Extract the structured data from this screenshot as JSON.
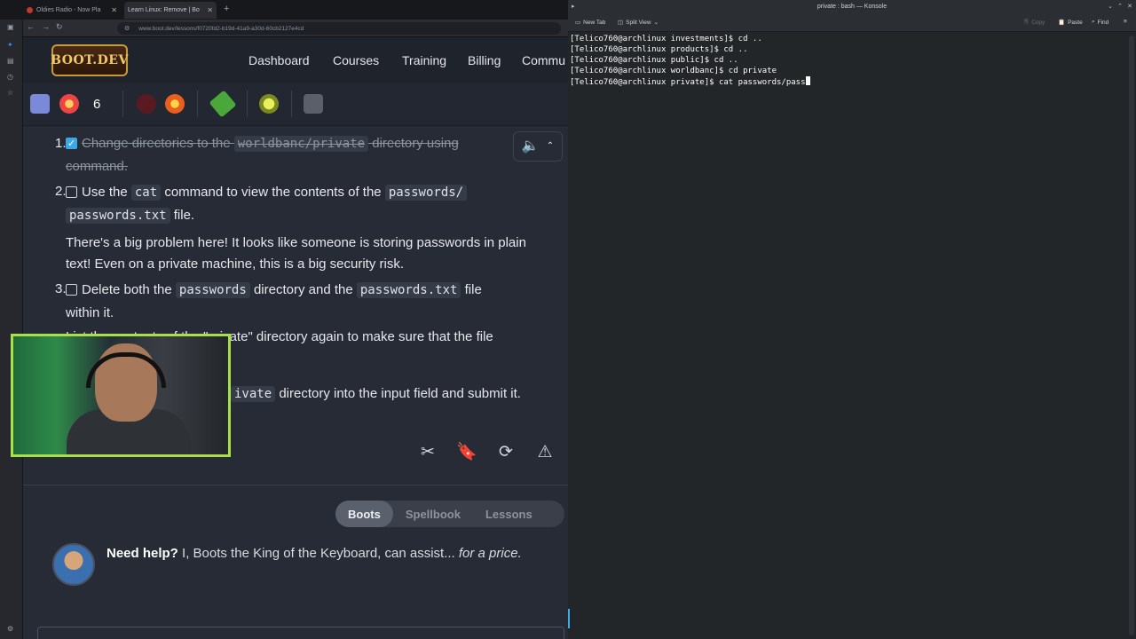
{
  "browser": {
    "tabs": [
      {
        "title": "Oldies Radio - Now Pla",
        "active": false
      },
      {
        "title": "Learn Linux: Remove | Bo",
        "active": true
      }
    ],
    "url": "www.boot.dev/lessons/f0720fd2-b19d-41a9-a30d-60cb2127e4cd"
  },
  "site": {
    "logo": "BOOT.DEV",
    "nav": [
      "Dashboard",
      "Courses",
      "Training",
      "Billing",
      "Commu"
    ],
    "streak_count": "6"
  },
  "lesson": {
    "steps": [
      {
        "num": "1.",
        "checked": true,
        "line1_pre": "Change directories to the ",
        "line1_code": "worldbanc/private",
        "line1_post": " directory using",
        "line2": "command."
      },
      {
        "num": "2.",
        "checked": false,
        "pre": "Use the ",
        "code1": "cat",
        "mid": " command to view the contents of the ",
        "code2": "passwords/",
        "code3": "passwords.txt",
        "post": " file."
      },
      {
        "num": "3.",
        "checked": false,
        "pre": "Delete both the ",
        "code1": "passwords",
        "mid": " directory and the ",
        "code2": "passwords.txt",
        "post": " file",
        "line2": "within it."
      }
    ],
    "note": "There's a big problem here! It looks like someone is storing passwords in plain text! Even on a private machine, this is a big security risk.",
    "step4_partial": "List the contents of the \"private\" directory again to make sure that the file",
    "step5_code": "ivate",
    "step5_post": " directory into the input field and submit it."
  },
  "help": {
    "tabs": [
      "Boots",
      "Spellbook",
      "Lessons"
    ],
    "active_tab": "Boots",
    "title": "Need help?",
    "text": " I, Boots the King of the Keyboard, can assist...",
    "italic": " for a price."
  },
  "terminal": {
    "window_title": "private : bash — Konsole",
    "toolbar": {
      "new_tab": "New Tab",
      "split_view": "Split View",
      "copy": "Copy",
      "paste": "Paste",
      "find": "Find"
    },
    "lines": [
      "[Telico760@archlinux investments]$ cd ..",
      "[Telico760@archlinux products]$ cd ..",
      "[Telico760@archlinux public]$ cd ..",
      "[Telico760@archlinux worldbanc]$ cd private",
      "[Telico760@archlinux private]$ cat passwords/pass"
    ]
  },
  "colors": {
    "accent": "#3daee9",
    "webcam_border": "#a8e04a",
    "checkbox_checked": "#3ba8e8"
  }
}
